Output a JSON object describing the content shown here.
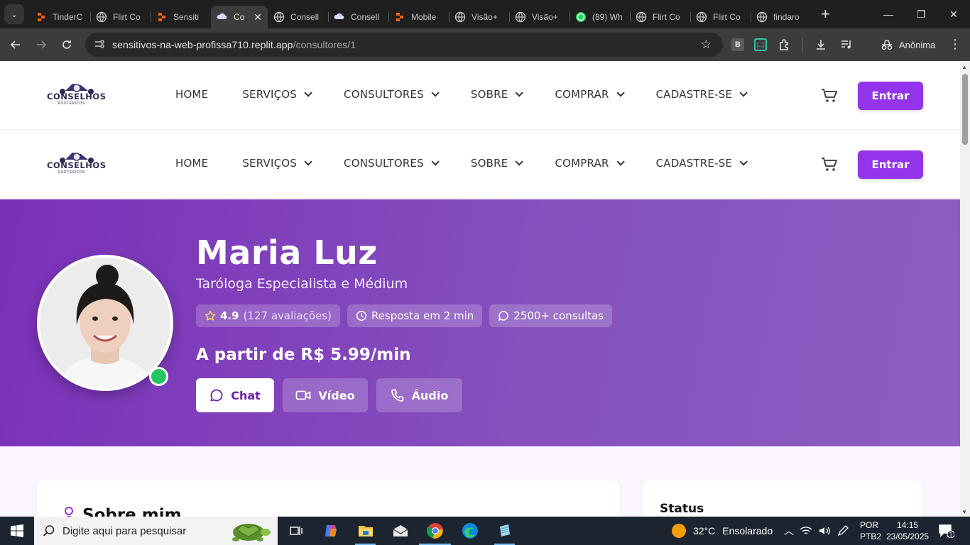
{
  "browser": {
    "tabs": [
      {
        "title": "TinderC",
        "icon": "replit-icon",
        "active": false
      },
      {
        "title": "Flirt Co",
        "icon": "globe-icon",
        "active": false
      },
      {
        "title": "Sensiti",
        "icon": "replit-icon",
        "active": false
      },
      {
        "title": "Co",
        "icon": "cloud-icon",
        "active": true
      },
      {
        "title": "Consell",
        "icon": "globe-icon",
        "active": false
      },
      {
        "title": "Consell",
        "icon": "cloud-icon",
        "active": false
      },
      {
        "title": "Mobile",
        "icon": "replit-icon",
        "active": false
      },
      {
        "title": "Visão+",
        "icon": "globe-icon",
        "active": false
      },
      {
        "title": "Visão+",
        "icon": "globe-icon",
        "active": false
      },
      {
        "title": "(89) Wh",
        "icon": "whatsapp-icon",
        "active": false
      },
      {
        "title": "Flirt Co",
        "icon": "globe-icon",
        "active": false
      },
      {
        "title": "Flirt Co",
        "icon": "globe-icon",
        "active": false
      },
      {
        "title": "findaro",
        "icon": "globe-icon",
        "active": false
      }
    ],
    "url_host": "sensitivos-na-web-profissa710.replit.app",
    "url_path": "/consultores/1",
    "profile_label": "Anônima",
    "extension_b": "B"
  },
  "site": {
    "brand_colors": {
      "primary": "#9333ea",
      "hero_start": "#7a30b9",
      "hero_end": "#8c5ec2"
    },
    "logo_text": "CONSELHOS",
    "logo_sub": "ESOTÉRICOS",
    "nav": [
      {
        "label": "HOME",
        "dropdown": false
      },
      {
        "label": "SERVIÇOS",
        "dropdown": true
      },
      {
        "label": "CONSULTORES",
        "dropdown": true
      },
      {
        "label": "SOBRE",
        "dropdown": true
      },
      {
        "label": "COMPRAR",
        "dropdown": true
      },
      {
        "label": "CADASTRE-SE",
        "dropdown": true
      }
    ],
    "login_label": "Entrar"
  },
  "profile": {
    "name": "Maria Luz",
    "title": "Taróloga Especialista e Médium",
    "rating": "4.9",
    "reviews": "(127 avaliações)",
    "response": "Resposta em 2 min",
    "consultations": "2500+ consultas",
    "price": "A partir de R$ 5.99/min",
    "online": true,
    "actions": {
      "chat": "Chat",
      "video": "Vídeo",
      "audio": "Áudio"
    }
  },
  "sections": {
    "about_title": "Sobre mim",
    "status_title": "Status"
  },
  "taskbar": {
    "search_placeholder": "Digite aqui para pesquisar",
    "temperature": "32°C",
    "weather": "Ensolarado",
    "lang_1": "POR",
    "lang_2": "PTB2",
    "time": "14:15",
    "date": "23/05/2025",
    "notifications": "1"
  }
}
